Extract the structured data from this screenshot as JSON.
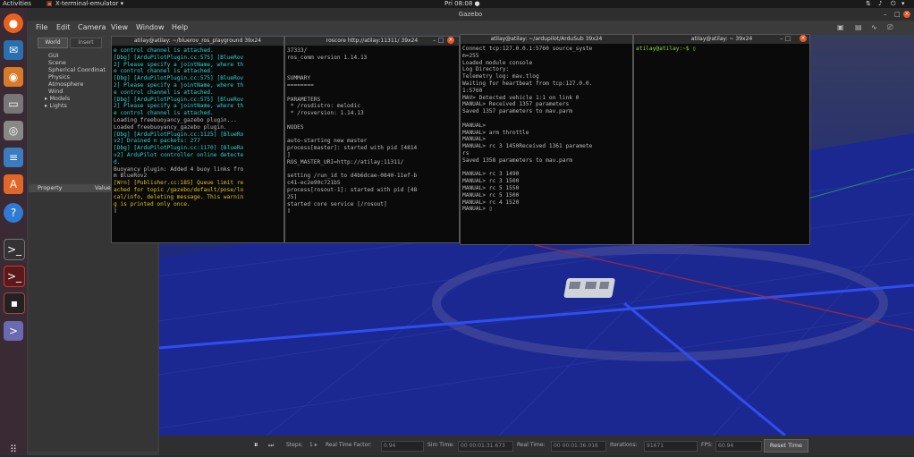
{
  "topbar": {
    "activities": "Activities",
    "app": "X-terminal-emulator ▾",
    "clock": "Pri 08:08 ●"
  },
  "dock": {
    "icons": [
      "firefox-icon",
      "thunderbird-icon",
      "rhythmbox-icon",
      "files-icon",
      "settings-icon",
      "writer-icon",
      "software-icon",
      "help-icon",
      "terminal-icon",
      "terminal-red-icon",
      "terminal-small-icon",
      "xterm-icon",
      "apps-grid-icon"
    ]
  },
  "gazebo": {
    "title": "Gazebo",
    "menu": [
      "File",
      "Edit",
      "Camera",
      "View",
      "Window",
      "Help"
    ],
    "tabs": [
      "World",
      "Insert"
    ],
    "tree": [
      "GUI",
      "Scene",
      "Spherical Coordinat",
      "Physics",
      "Atmosphere",
      "Wind",
      "▸ Models",
      "▸ Lights"
    ],
    "prop_header": [
      "Property",
      "Value"
    ],
    "bottom": {
      "steps_label": "Steps:",
      "steps_value": "1 ▸",
      "rtf_label": "Real Time Factor:",
      "rtf_value": "0.94",
      "sim_label": "Sim Time:",
      "sim_value": "00 00:01:31.673",
      "real_label": "Real Time:",
      "real_value": "00 00:01:36.016",
      "iter_label": "Iterations:",
      "iter_value": "91671",
      "fps_label": "FPS:",
      "fps_value": "60.94",
      "reset_label": "Reset Time"
    }
  },
  "terminals": [
    {
      "title": "atilay@atilay: ~/bluerov_ros_playground 39x24",
      "lines": [
        {
          "t": "e control channel is attached.",
          "c": "#2bd3d3"
        },
        {
          "t": "[Dbg] [ArduPilotPlugin.cc:575] [BlueRov",
          "c": "#2bd3d3"
        },
        {
          "t": "2] Please specify a jointName, where th",
          "c": "#2bd3d3"
        },
        {
          "t": "e control channel is attached.",
          "c": "#2bd3d3"
        },
        {
          "t": "[Dbg] [ArduPilotPlugin.cc:575] [BlueRov",
          "c": "#2bd3d3"
        },
        {
          "t": "2] Please specify a jointName, where th",
          "c": "#2bd3d3"
        },
        {
          "t": "e control channel is attached.",
          "c": "#2bd3d3"
        },
        {
          "t": "[Dbg] [ArduPilotPlugin.cc:575] [BlueRov",
          "c": "#2bd3d3"
        },
        {
          "t": "2] Please specify a jointName, where th",
          "c": "#2bd3d3"
        },
        {
          "t": "e control channel is attached.",
          "c": "#2bd3d3"
        },
        {
          "t": "Loading freebuoyancy_gazebo plugin...",
          "c": "#bbbbbb"
        },
        {
          "t": "Loaded freebuoyancy_gazebo plugin.",
          "c": "#bbbbbb"
        },
        {
          "t": "[Dbg] [ArduPilotPlugin.cc:1125] [BlueRo",
          "c": "#2bd3d3"
        },
        {
          "t": "v2] Drained n packets: 277",
          "c": "#2bd3d3"
        },
        {
          "t": "[Dbg] [ArduPilotPlugin.cc:1170] [BlueRo",
          "c": "#2bd3d3"
        },
        {
          "t": "v2] ArduPilot controller online detecte",
          "c": "#2bd3d3"
        },
        {
          "t": "d.",
          "c": "#2bd3d3"
        },
        {
          "t": "Buoyancy plugin: Added 4 buoy links fro",
          "c": "#bbbbbb"
        },
        {
          "t": "m BlueRov2",
          "c": "#bbbbbb"
        },
        {
          "t": "[Wrn] [Publisher.cc:185] Queue limit re",
          "c": "#e0c020"
        },
        {
          "t": "ached for topic /gazebo/default/pose/lo",
          "c": "#e0c020"
        },
        {
          "t": "cal/info, deleting message. This warnin",
          "c": "#e0c020"
        },
        {
          "t": "g is printed only once.",
          "c": "#e0c020"
        },
        {
          "t": "▯",
          "c": "#bbbbbb"
        }
      ]
    },
    {
      "title": "roscore http://atilay:11311/ 39x24",
      "lines": [
        {
          "t": "37333/",
          "c": "#bbbbbb"
        },
        {
          "t": "ros_comm version 1.14.13",
          "c": "#bbbbbb"
        },
        {
          "t": "",
          "c": "#bbbbbb"
        },
        {
          "t": "",
          "c": "#bbbbbb"
        },
        {
          "t": "SUMMARY",
          "c": "#bbbbbb"
        },
        {
          "t": "========",
          "c": "#bbbbbb"
        },
        {
          "t": "",
          "c": "#bbbbbb"
        },
        {
          "t": "PARAMETERS",
          "c": "#bbbbbb"
        },
        {
          "t": " * /rosdistro: melodic",
          "c": "#bbbbbb"
        },
        {
          "t": " * /rosversion: 1.14.13",
          "c": "#bbbbbb"
        },
        {
          "t": "",
          "c": "#bbbbbb"
        },
        {
          "t": "NODES",
          "c": "#bbbbbb"
        },
        {
          "t": "",
          "c": "#bbbbbb"
        },
        {
          "t": "auto-starting new master",
          "c": "#bbbbbb"
        },
        {
          "t": "process[master]: started with pid [4814",
          "c": "#bbbbbb"
        },
        {
          "t": "]",
          "c": "#bbbbbb"
        },
        {
          "t": "ROS_MASTER_URI=http://atilay:11311/",
          "c": "#bbbbbb"
        },
        {
          "t": "",
          "c": "#bbbbbb"
        },
        {
          "t": "setting /run_id to d4b6dcae-0840-11ef-b",
          "c": "#bbbbbb"
        },
        {
          "t": "c41-ec2e90c721b5",
          "c": "#bbbbbb"
        },
        {
          "t": "process[rosout-1]: started with pid [48",
          "c": "#bbbbbb"
        },
        {
          "t": "25]",
          "c": "#bbbbbb"
        },
        {
          "t": "started core service [/rosout]",
          "c": "#bbbbbb"
        },
        {
          "t": "▯",
          "c": "#bbbbbb"
        }
      ]
    },
    {
      "title": "atilay@atilay: ~/ardupilot/ArduSub 39x24",
      "lines": [
        {
          "t": "Connect tcp:127.0.0.1:5760 source_syste",
          "c": "#bbbbbb"
        },
        {
          "t": "m=255",
          "c": "#bbbbbb"
        },
        {
          "t": "Loaded module console",
          "c": "#bbbbbb"
        },
        {
          "t": "Log Directory:",
          "c": "#bbbbbb"
        },
        {
          "t": "Telemetry log: mav.tlog",
          "c": "#bbbbbb"
        },
        {
          "t": "Waiting for heartbeat from tcp:127.0.0.",
          "c": "#bbbbbb"
        },
        {
          "t": "1:5760",
          "c": "#bbbbbb"
        },
        {
          "t": "MAV> Detected vehicle 1:1 on link 0",
          "c": "#bbbbbb"
        },
        {
          "t": "MANUAL> Received 1357 parameters",
          "c": "#bbbbbb"
        },
        {
          "t": "Saved 1357 parameters to mav.parm",
          "c": "#bbbbbb"
        },
        {
          "t": "",
          "c": "#bbbbbb"
        },
        {
          "t": "MANUAL>",
          "c": "#bbbbbb"
        },
        {
          "t": "MANUAL> arm throttle",
          "c": "#bbbbbb"
        },
        {
          "t": "MANUAL>",
          "c": "#bbbbbb"
        },
        {
          "t": "MANUAL> rc 3 1450Received 1361 paramete",
          "c": "#bbbbbb"
        },
        {
          "t": "rs",
          "c": "#bbbbbb"
        },
        {
          "t": "Saved 1358 parameters to mav.parm",
          "c": "#bbbbbb"
        },
        {
          "t": "",
          "c": "#bbbbbb"
        },
        {
          "t": "MANUAL> rc 3 1490",
          "c": "#bbbbbb"
        },
        {
          "t": "MANUAL> rc 3 1500",
          "c": "#bbbbbb"
        },
        {
          "t": "MANUAL> rc 5 1550",
          "c": "#bbbbbb"
        },
        {
          "t": "MANUAL> rc 5 1500",
          "c": "#bbbbbb"
        },
        {
          "t": "MANUAL> rc 4 1520",
          "c": "#bbbbbb"
        },
        {
          "t": "MANUAL> ▯",
          "c": "#bbbbbb"
        }
      ]
    },
    {
      "title": "atilay@atilay: ~ 39x24",
      "lines": [
        {
          "t": "atilay@atilay:~$ ▯",
          "c": "#8ae234"
        }
      ]
    }
  ]
}
